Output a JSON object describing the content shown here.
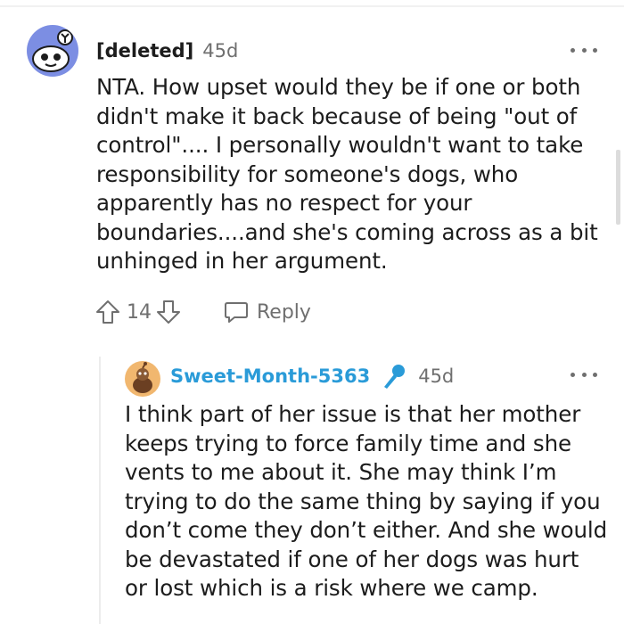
{
  "comment": {
    "author": "[deleted]",
    "age": "45d",
    "body": "NTA. How upset would they be if one or both\ndidn't make it back because of being \"out of\ncontrol\".... I personally wouldn't want to take\nresponsibility for someone's dogs, who\napparently has no respect for your\nboundaries....and she's coming across as a bit\nunhinged in her argument.",
    "vote_count": "14",
    "reply_label": "Reply"
  },
  "reply": {
    "author": "Sweet-Month-5363",
    "age": "45d",
    "body": "I think part of her issue is that her mother\nkeeps trying to force family time and she\nvents to me about it. She may think I’m\ntrying to do the same thing by saying if you\ndon’t come they don’t either. And she would\nbe devastated if one of her dogs was hurt\nor lost which is a risk where we camp."
  },
  "colors": {
    "username_link": "#2a9bd8",
    "default_avatar": "#7c8ee3",
    "reply_avatar": "#f1b76f",
    "muted_text": "#6f6f6f"
  },
  "icons": {
    "more": "more-options-icon",
    "upvote": "upvote-arrow-icon",
    "downvote": "downvote-arrow-icon",
    "reply": "speech-bubble-icon",
    "talk": "microphone-icon"
  }
}
